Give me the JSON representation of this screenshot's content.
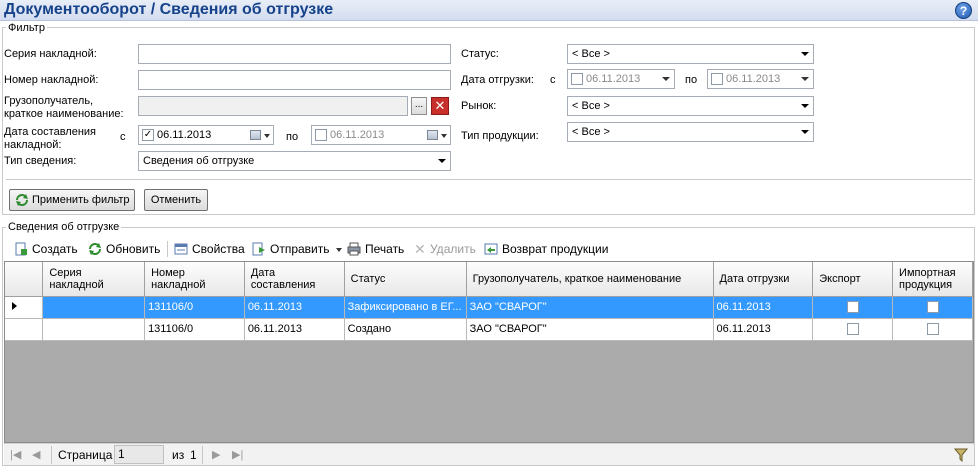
{
  "app": {
    "title": "Документооборот  / Сведения об отгрузке",
    "help_icon": "?"
  },
  "filter": {
    "legend": "Фильтр",
    "series_label": "Серия накладной:",
    "series_value": "",
    "number_label": "Номер накладной:",
    "number_value": "",
    "consignee_label_1": "Грузополучатель,",
    "consignee_label_2": "краткое наименование:",
    "consignee_value": "",
    "browse_label": "...",
    "clear_label": "✕",
    "date_made_label_1": "Дата составления",
    "date_made_label_2": "накладной:",
    "from_label": "с",
    "to_label": "по",
    "date_made_from": "06.11.2013",
    "date_made_from_checked": true,
    "date_made_to": "06.11.2013",
    "info_type_label": "Тип сведения:",
    "info_type_value": "Сведения об отгрузке",
    "status_label": "Статус:",
    "status_value": "< Все >",
    "ship_date_label": "Дата отгрузки:",
    "ship_from": "06.11.2013",
    "ship_to": "06.11.2013",
    "market_label": "Рынок:",
    "market_value": "< Все >",
    "product_type_label": "Тип продукции:",
    "product_type_value": "< Все >",
    "apply_label": "Применить фильтр",
    "cancel_label": "Отменить"
  },
  "section": {
    "legend": "Сведения об отгрузке"
  },
  "toolbar": {
    "create": "Создать",
    "refresh": "Обновить",
    "properties": "Свойства",
    "send": "Отправить",
    "print": "Печать",
    "delete": "Удалить",
    "return": "Возврат продукции"
  },
  "grid": {
    "columns": [
      "Серия накладной",
      "Номер накладной",
      "Дата составления",
      "Статус",
      "Грузополучатель, краткое наименование",
      "Дата отгрузки",
      "Экспорт",
      "Импортная продукция"
    ],
    "rows": [
      {
        "series": "",
        "number": "131106/0",
        "date": "06.11.2013",
        "status": "Зафиксировано в ЕГ...",
        "consignee": "ЗАО \"СВАРОГ\"",
        "ship_date": "06.11.2013",
        "export": false,
        "import": false,
        "selected": true
      },
      {
        "series": "",
        "number": "131106/0",
        "date": "06.11.2013",
        "status": "Создано",
        "consignee": "ЗАО \"СВАРОГ\"",
        "ship_date": "06.11.2013",
        "export": false,
        "import": false,
        "selected": false
      }
    ]
  },
  "pager": {
    "page_label": "Страница",
    "page_value": "1",
    "of_label": "из",
    "total_pages": "1"
  }
}
